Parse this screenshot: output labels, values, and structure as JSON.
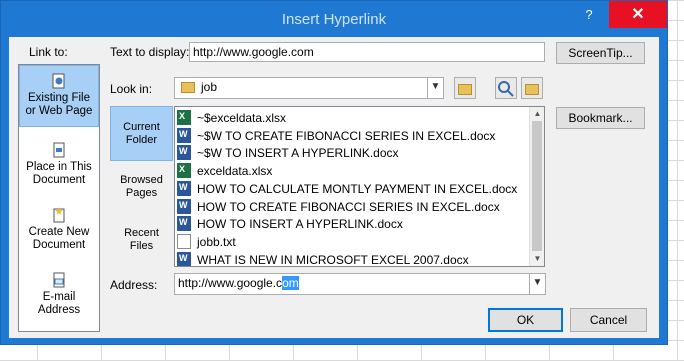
{
  "dialog": {
    "title": "Insert Hyperlink",
    "help": "?",
    "close": "✕"
  },
  "link_to": {
    "label": "Link to:",
    "items": [
      {
        "line1": "Existing File",
        "line2": "or Web Page"
      },
      {
        "line1": "Place in This",
        "line2": "Document"
      },
      {
        "line1": "Create New",
        "line2": "Document"
      },
      {
        "line1": "E-mail",
        "line2": "Address"
      }
    ]
  },
  "text_to_display": {
    "label": "Text to display:",
    "value": "http://www.google.com"
  },
  "screentip_label": "ScreenTip...",
  "look_in": {
    "label": "Look in:",
    "value": "job"
  },
  "bookmark_label": "Bookmark...",
  "section_tabs": [
    {
      "line1": "Current",
      "line2": "Folder"
    },
    {
      "line1": "Browsed",
      "line2": "Pages"
    },
    {
      "line1": "Recent",
      "line2": "Files"
    }
  ],
  "files": [
    {
      "name": "~$exceldata.xlsx",
      "type": "xls"
    },
    {
      "name": "~$W TO CREATE FIBONACCI SERIES IN EXCEL.docx",
      "type": "doc"
    },
    {
      "name": "~$W TO INSERT A HYPERLINK.docx",
      "type": "doc"
    },
    {
      "name": "exceldata.xlsx",
      "type": "xls"
    },
    {
      "name": "HOW TO CALCULATE MONTLY PAYMENT IN EXCEL.docx",
      "type": "doc"
    },
    {
      "name": "HOW TO CREATE FIBONACCI SERIES IN EXCEL.docx",
      "type": "doc"
    },
    {
      "name": "HOW TO INSERT A HYPERLINK.docx",
      "type": "doc"
    },
    {
      "name": "jobb.txt",
      "type": "txt"
    },
    {
      "name": "WHAT IS NEW IN MICROSOFT EXCEL 2007.docx",
      "type": "doc"
    }
  ],
  "address": {
    "label": "Address:",
    "value_plain": "http://www.google.c",
    "value_selected": "om"
  },
  "ok_label": "OK",
  "cancel_label": "Cancel",
  "colors": {
    "titlebar": "#1f79d3",
    "close": "#e81123",
    "selection": "#a8cff5"
  }
}
